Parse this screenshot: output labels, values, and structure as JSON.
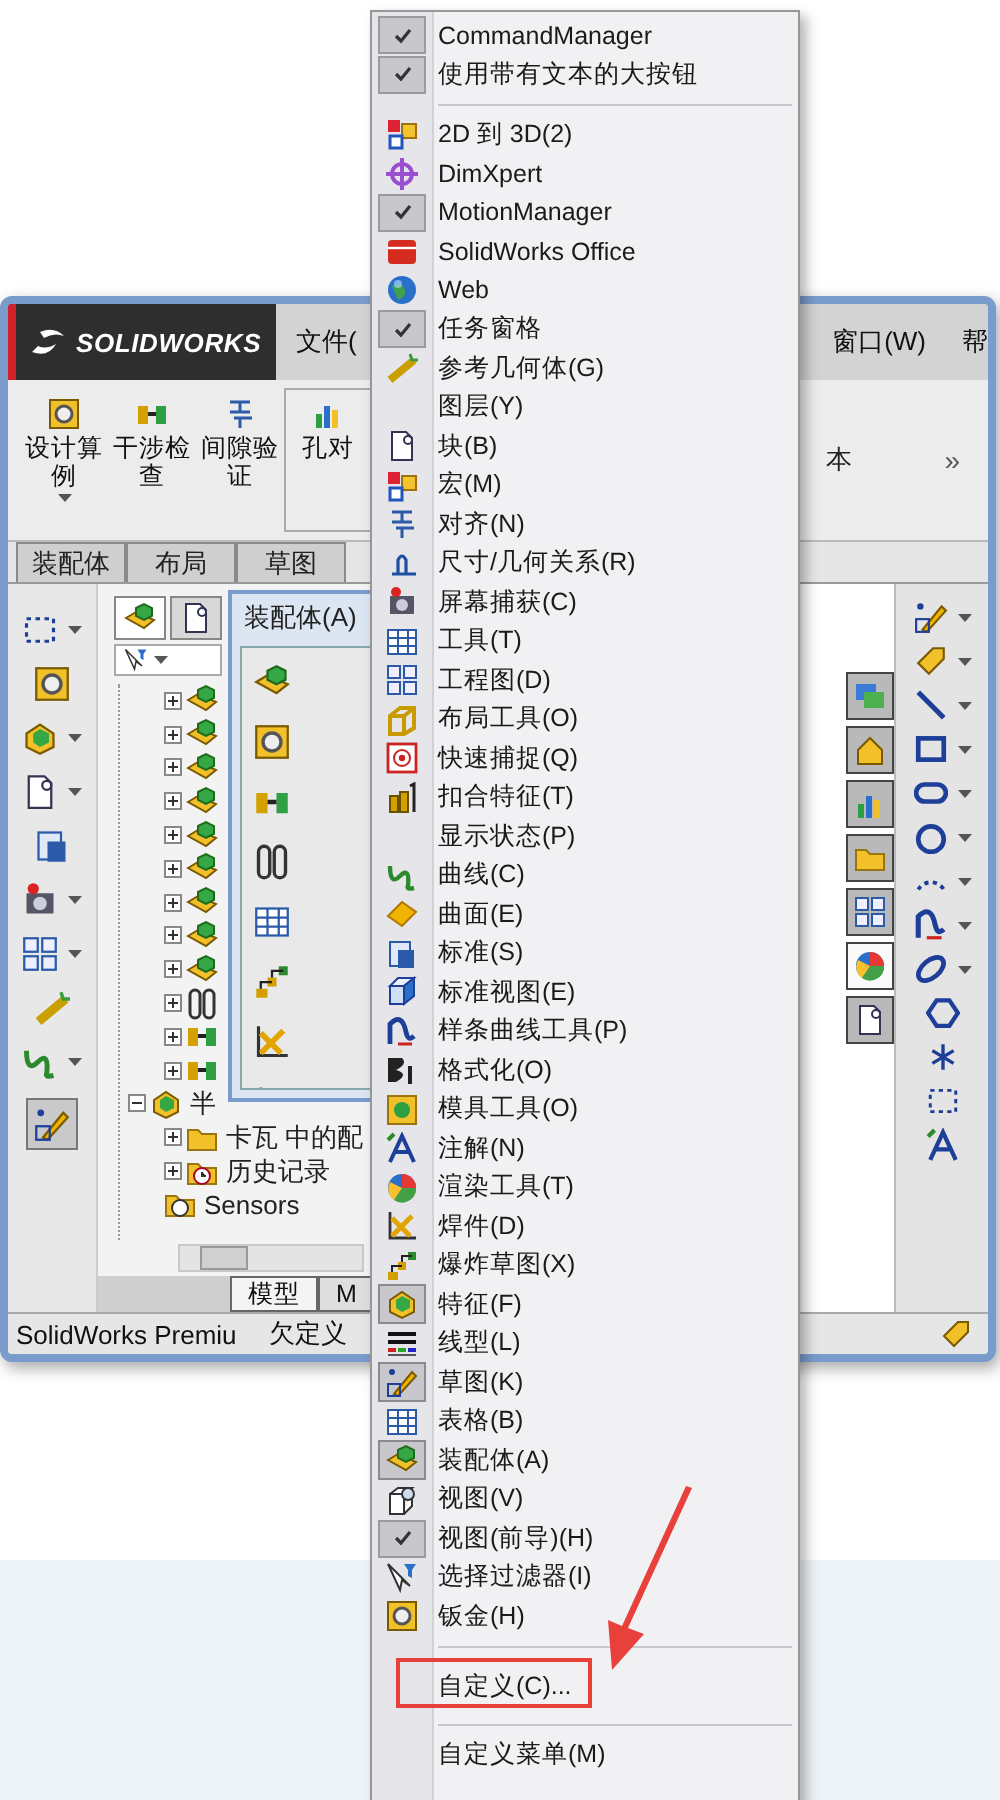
{
  "window": {
    "logo": "SOLIDWORKS",
    "menu": [
      "文件(",
      "窗口(W)",
      "帮"
    ],
    "ribbon": {
      "buttons": [
        {
          "label": "设计算例",
          "dropdown": true
        },
        {
          "label": "干涉检查",
          "dropdown": false
        },
        {
          "label": "间隙验证",
          "dropdown": false
        },
        {
          "label": "孔对",
          "dropdown": false
        }
      ],
      "right_label": "本",
      "overflow": "»"
    },
    "tabs": [
      {
        "label": "装配体",
        "selected": false
      },
      {
        "label": "布局",
        "selected": false
      },
      {
        "label": "草图",
        "selected": false
      }
    ],
    "tree": {
      "items": [
        {
          "kind": "part",
          "expanded": false
        },
        {
          "kind": "part",
          "expanded": false
        },
        {
          "kind": "part",
          "expanded": false
        },
        {
          "kind": "part",
          "expanded": false
        },
        {
          "kind": "part",
          "expanded": false
        },
        {
          "kind": "part",
          "expanded": false
        },
        {
          "kind": "part",
          "expanded": false
        },
        {
          "kind": "part",
          "expanded": false
        },
        {
          "kind": "part",
          "expanded": false
        },
        {
          "kind": "clip",
          "expanded": false
        },
        {
          "kind": "mate",
          "expanded": false
        },
        {
          "kind": "mate",
          "expanded": false
        },
        {
          "kind": "assembly",
          "label": "半",
          "expanded": true,
          "children": [
            {
              "kind": "folder",
              "label": "卡瓦 中的配",
              "expanded": false
            },
            {
              "kind": "history",
              "label": "历史记录",
              "expanded": false
            },
            {
              "kind": "sensor",
              "label": "Sensors"
            }
          ]
        }
      ]
    },
    "floating_toolbar": {
      "title": "装配体(A)"
    },
    "task_pane_tabs": [
      {
        "selected": false
      },
      {
        "selected": false
      },
      {
        "selected": false
      },
      {
        "selected": false
      },
      {
        "selected": false
      },
      {
        "selected": true
      },
      {
        "selected": false
      }
    ],
    "bottom_tabs": [
      {
        "label": "模型",
        "selected": true
      },
      {
        "label": "M",
        "selected": false
      }
    ],
    "status_bar": [
      "SolidWorks Premiu",
      "欠定义"
    ]
  },
  "context_menu": {
    "items": [
      {
        "kind": "check",
        "label": "CommandManager",
        "checked": true
      },
      {
        "kind": "check",
        "label": "使用带有文本的大按钮",
        "checked": true
      },
      {
        "kind": "separator"
      },
      {
        "kind": "icon",
        "label": "2D 到 3D(2)",
        "active": false
      },
      {
        "kind": "icon",
        "label": "DimXpert",
        "active": false
      },
      {
        "kind": "check",
        "label": "MotionManager",
        "checked": true
      },
      {
        "kind": "icon",
        "label": "SolidWorks Office",
        "active": false
      },
      {
        "kind": "icon",
        "label": "Web",
        "active": false
      },
      {
        "kind": "check",
        "label": "任务窗格",
        "checked": true
      },
      {
        "kind": "icon",
        "label": "参考几何体(G)",
        "active": false
      },
      {
        "kind": "plain",
        "label": "图层(Y)"
      },
      {
        "kind": "icon",
        "label": "块(B)",
        "active": false
      },
      {
        "kind": "icon",
        "label": "宏(M)",
        "active": false
      },
      {
        "kind": "icon",
        "label": "对齐(N)",
        "active": false
      },
      {
        "kind": "icon",
        "label": "尺寸/几何关系(R)",
        "active": false
      },
      {
        "kind": "icon",
        "label": "屏幕捕获(C)",
        "active": false
      },
      {
        "kind": "icon",
        "label": "工具(T)",
        "active": false
      },
      {
        "kind": "icon",
        "label": "工程图(D)",
        "active": false
      },
      {
        "kind": "icon",
        "label": "布局工具(O)",
        "active": false
      },
      {
        "kind": "icon",
        "label": "快速捕捉(Q)",
        "active": false
      },
      {
        "kind": "icon",
        "label": "扣合特征(T)",
        "active": false
      },
      {
        "kind": "plain",
        "label": "显示状态(P)"
      },
      {
        "kind": "icon",
        "label": "曲线(C)",
        "active": false
      },
      {
        "kind": "icon",
        "label": "曲面(E)",
        "active": false
      },
      {
        "kind": "icon",
        "label": "标准(S)",
        "active": false
      },
      {
        "kind": "icon",
        "label": "标准视图(E)",
        "active": false
      },
      {
        "kind": "icon",
        "label": "样条曲线工具(P)",
        "active": false
      },
      {
        "kind": "icon",
        "label": "格式化(O)",
        "active": false
      },
      {
        "kind": "icon",
        "label": "模具工具(O)",
        "active": false
      },
      {
        "kind": "icon",
        "label": "注解(N)",
        "active": false
      },
      {
        "kind": "icon",
        "label": "渲染工具(T)",
        "active": false
      },
      {
        "kind": "icon",
        "label": "焊件(D)",
        "active": false
      },
      {
        "kind": "icon",
        "label": "爆炸草图(X)",
        "active": false
      },
      {
        "kind": "icon",
        "label": "特征(F)",
        "active": true
      },
      {
        "kind": "icon",
        "label": "线型(L)",
        "active": false
      },
      {
        "kind": "icon",
        "label": "草图(K)",
        "active": true
      },
      {
        "kind": "icon",
        "label": "表格(B)",
        "active": false
      },
      {
        "kind": "icon",
        "label": "装配体(A)",
        "active": true
      },
      {
        "kind": "icon",
        "label": "视图(V)",
        "active": false
      },
      {
        "kind": "check",
        "label": "视图(前导)(H)",
        "checked": true
      },
      {
        "kind": "icon",
        "label": "选择过滤器(I)",
        "active": false
      },
      {
        "kind": "icon",
        "label": "钣金(H)",
        "active": false
      },
      {
        "kind": "separator"
      },
      {
        "kind": "command",
        "label": "自定义(C)...",
        "highlighted": true
      },
      {
        "kind": "separator"
      },
      {
        "kind": "command",
        "label": "自定义菜单(M)",
        "highlighted": false
      }
    ]
  }
}
